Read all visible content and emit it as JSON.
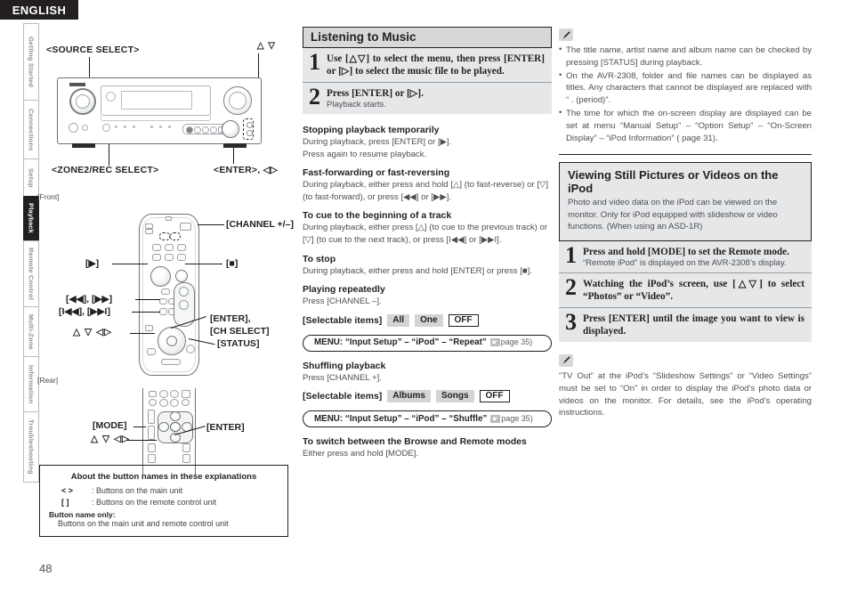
{
  "language_banner": "ENGLISH",
  "page_number": "48",
  "side_tabs": [
    {
      "label": "Getting Started",
      "active": false
    },
    {
      "label": "Connections",
      "active": false
    },
    {
      "label": "Setup",
      "active": false
    },
    {
      "label": "Playback",
      "active": true
    },
    {
      "label": "Remote Control",
      "active": false
    },
    {
      "label": "Multi-Zone",
      "active": false
    },
    {
      "label": "Information",
      "active": false
    },
    {
      "label": "Troubleshooting",
      "active": false
    }
  ],
  "left": {
    "unit_labels": {
      "source_select": "<SOURCE SELECT>",
      "updown": "△ ▽",
      "zone2_rec_select": "<ZONE2/REC SELECT>",
      "enter_leftright": "<ENTER>, ◁▷"
    },
    "front_caption": "[Front]",
    "rear_caption": "[Rear]",
    "remote_front_labels": {
      "channel": "[CHANNEL +/–]",
      "play": "[▶]",
      "stop": "[■]",
      "scan": "[◀◀], [▶▶]",
      "skip": "[I◀◀], [▶▶I]",
      "enter_chselect_line1": "[ENTER],",
      "enter_chselect_line2": "[CH SELECT]",
      "cursor": "△ ▽ ◁▷",
      "status": "[STATUS]"
    },
    "remote_rear_labels": {
      "mode": "[MODE]",
      "cursor": "△ ▽ ◁▷",
      "enter": "[ENTER]"
    },
    "about_box": {
      "title": "About the button names in these explanations",
      "row1_key": "<    >",
      "row1_val": ": Buttons on the main unit",
      "row2_key": "[     ]",
      "row2_val": ": Buttons on the remote control unit",
      "sub_title": "Button name only:",
      "sub_text": "Buttons on the main unit and remote control unit"
    }
  },
  "middle": {
    "section_title": "Listening to Music",
    "steps": [
      {
        "num": "1",
        "text": "Use [△▽] to select the menu, then press [ENTER] or [▷] to select the music file to be played.",
        "sub": ""
      },
      {
        "num": "2",
        "text": "Press [ENTER] or [▷].",
        "sub": "Playback starts."
      }
    ],
    "topics": [
      {
        "heading": "Stopping playback temporarily",
        "lines": [
          "During playback, press [ENTER] or [▶].",
          "Press again to resume playback."
        ]
      },
      {
        "heading": "Fast-forwarding or fast-reversing",
        "lines": [
          "During playback, either press and hold [△] (to fast-reverse) or [▽] (to fast-forward), or press [◀◀] or [▶▶]."
        ]
      },
      {
        "heading": "To cue to the beginning of a track",
        "lines": [
          "During playback, either press [△] (to cue to the previous track) or [▽] (to cue to the next track), or press [I◀◀] or [▶▶I]."
        ]
      },
      {
        "heading": "To stop",
        "lines": [
          "During playback, either press and hold [ENTER] or press [■]."
        ]
      },
      {
        "heading": "Playing repeatedly",
        "lines": [
          "Press [CHANNEL –]."
        ]
      }
    ],
    "repeat_items": {
      "label": "[Selectable items]",
      "chips": [
        "All",
        "One"
      ],
      "off_chip": "OFF"
    },
    "repeat_menu": {
      "prefix": "MENU",
      "path": ": “Input Setup” – “iPod” – “Repeat”",
      "page_ref": "page 35)"
    },
    "shuffle": {
      "heading": "Shuffling playback",
      "line": "Press [CHANNEL +]."
    },
    "shuffle_items": {
      "label": "[Selectable items]",
      "chips": [
        "Albums",
        "Songs"
      ],
      "off_chip": "OFF"
    },
    "shuffle_menu": {
      "prefix": "MENU",
      "path": ": “Input Setup” – “iPod” – “Shuffle”",
      "page_ref": "page 35)"
    },
    "switch_modes": {
      "heading": "To switch between the Browse and Remote modes",
      "line": "Either press and hold [MODE]."
    }
  },
  "right": {
    "note_icon": "pencil-icon",
    "top_bullets": [
      "The title name, artist name and album name can be checked by pressing [STATUS] during playback.",
      "On the AVR-2308, folder and file names can be displayed as titles. Any characters that cannot be displayed are replaced with “ . (period)”.",
      "The time for which the on-screen display are displayed can be set at menu “Manual Setup” – “Option Setup” – “On-Screen Display” – “iPod Information” ( page 31)."
    ],
    "infobox": {
      "title": "Viewing Still Pictures or Videos on the iPod",
      "body": "Photo and video data on the iPod can be viewed on the monitor. Only for iPod equipped with slideshow or video functions. (When using an ASD-1R)"
    },
    "steps": [
      {
        "num": "1",
        "text": "Press and hold [MODE] to set the Remote mode.",
        "sub": "“Remote iPod” is displayed on the AVR-2308’s display."
      },
      {
        "num": "2",
        "text": "Watching the iPod’s screen, use [△▽] to select “Photos” or “Video”.",
        "sub": ""
      },
      {
        "num": "3",
        "text": "Press [ENTER] until the image you want to view is displayed.",
        "sub": ""
      }
    ],
    "bottom_note": "“TV Out” at the iPod’s “Slideshow Settings” or “Video Settings” must be set to “On” in order to display the iPod’s photo data or videos on the monitor. For details, see the iPod’s operating instructions."
  }
}
